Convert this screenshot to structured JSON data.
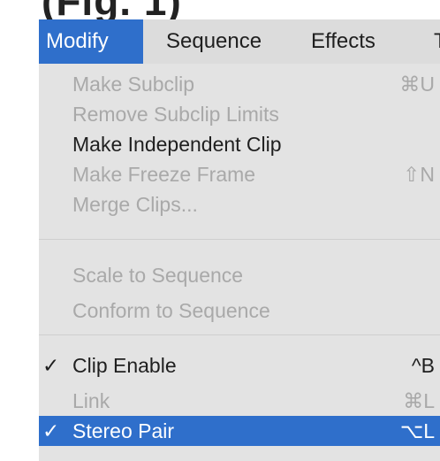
{
  "caption_fragment": "(Fig. 1)",
  "menubar": {
    "items": [
      {
        "label": "Modify"
      },
      {
        "label": "Sequence"
      },
      {
        "label": "Effects"
      },
      {
        "label": "T"
      }
    ]
  },
  "menu": {
    "groups": [
      {
        "items": [
          {
            "label": "Make Subclip",
            "shortcut": "⌘U",
            "enabled": false,
            "checked": false
          },
          {
            "label": "Remove Subclip Limits",
            "shortcut": "",
            "enabled": false,
            "checked": false
          },
          {
            "label": "Make Independent Clip",
            "shortcut": "",
            "enabled": true,
            "checked": false
          },
          {
            "label": "Make Freeze Frame",
            "shortcut": "⇧N",
            "enabled": false,
            "checked": false
          },
          {
            "label": "Merge Clips...",
            "shortcut": "",
            "enabled": false,
            "checked": false
          }
        ]
      },
      {
        "items": [
          {
            "label": "Scale to Sequence",
            "shortcut": "",
            "enabled": false,
            "checked": false
          },
          {
            "label": "Conform to Sequence",
            "shortcut": "",
            "enabled": false,
            "checked": false
          }
        ]
      },
      {
        "items": [
          {
            "label": "Clip Enable",
            "shortcut": "^B",
            "enabled": true,
            "checked": true
          },
          {
            "label": "Link",
            "shortcut": "⌘L",
            "enabled": false,
            "checked": false
          },
          {
            "label": "Stereo Pair",
            "shortcut": "⌥L",
            "enabled": true,
            "checked": true
          }
        ]
      }
    ],
    "check_glyph": "✓"
  },
  "colors": {
    "highlight": "#2f6fcb",
    "menu_bg": "#e3e3e3",
    "menubar_bg": "#dcdcdc",
    "disabled_text": "#a9a9a9",
    "enabled_text": "#1f1f1f"
  }
}
